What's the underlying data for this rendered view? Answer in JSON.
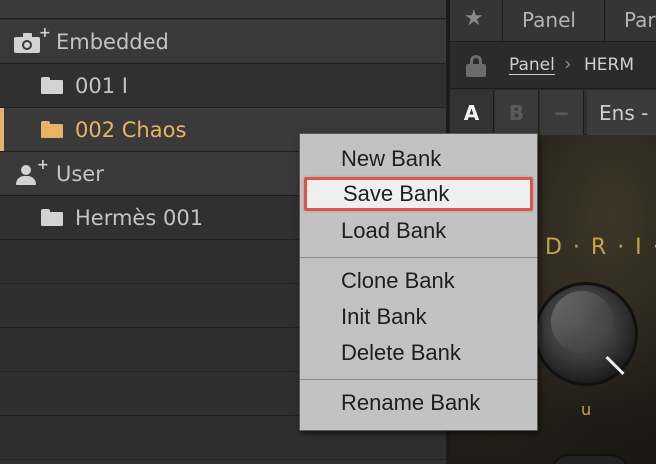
{
  "browser": {
    "sections": [
      {
        "label": "Embedded",
        "icon": "camera-plus-icon"
      },
      {
        "label": "User",
        "icon": "user-plus-icon"
      }
    ],
    "banks": [
      {
        "label": "001 I",
        "selected": false
      },
      {
        "label": "002 Chaos",
        "selected": true
      },
      {
        "label": "Hermès 001",
        "selected": false
      }
    ]
  },
  "panel": {
    "tabs": [
      "Panel",
      "Par"
    ],
    "breadcrumb": {
      "root": "Panel",
      "current": "HERM"
    },
    "ab": {
      "a": "A",
      "b": "B",
      "minus": "−"
    },
    "preset": "Ens -",
    "control_label": "D · R · I · ",
    "knob_sub": "u"
  },
  "context_menu": {
    "groups": [
      [
        "New Bank",
        "Save Bank",
        "Load Bank"
      ],
      [
        "Clone Bank",
        "Init Bank",
        "Delete Bank"
      ],
      [
        "Rename Bank"
      ]
    ],
    "highlighted": "Save Bank"
  },
  "colors": {
    "accent_selected": "#e7b366",
    "menu_highlight_border": "#d9584e",
    "menu_bg": "#c2c2c2",
    "plugin_gold": "#c9a24c"
  }
}
